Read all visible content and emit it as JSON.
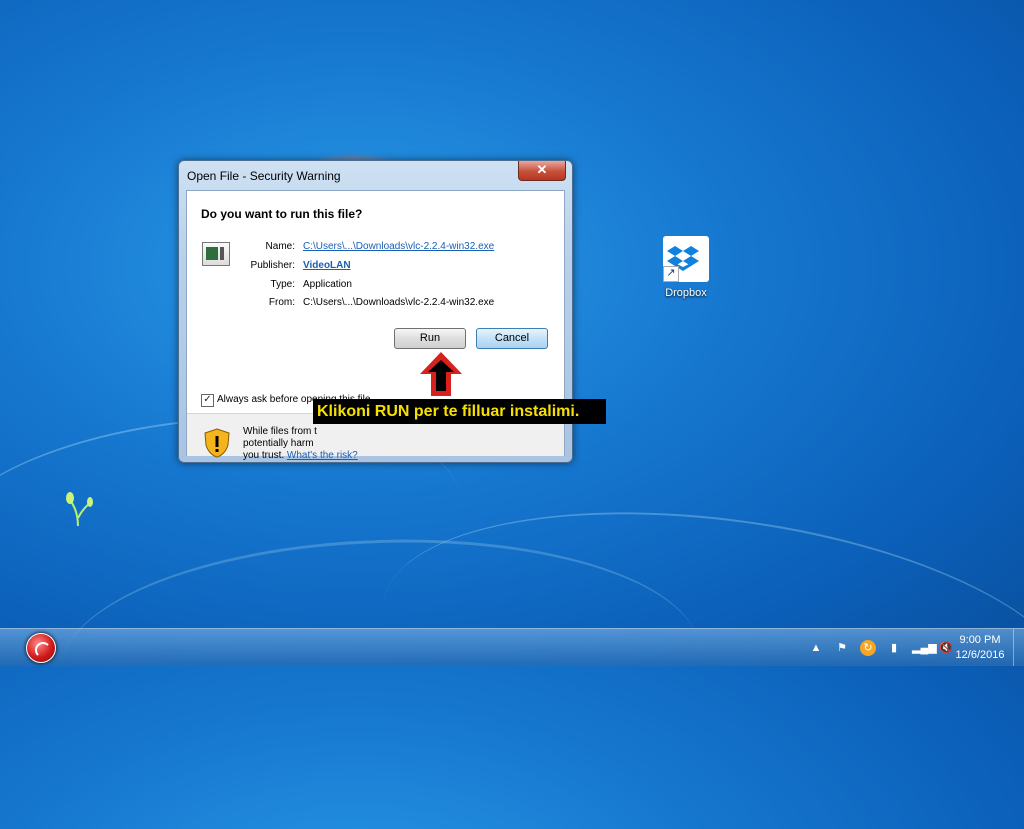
{
  "dialog": {
    "title": "Open File - Security Warning",
    "close_glyph": "✕",
    "question": "Do you want to run this file?",
    "name_label": "Name:",
    "name_value": "C:\\Users\\...\\Downloads\\vlc-2.2.4-win32.exe",
    "publisher_label": "Publisher:",
    "publisher_value": "VideoLAN",
    "type_label": "Type:",
    "type_value": "Application",
    "from_label": "From:",
    "from_value": "C:\\Users\\...\\Downloads\\vlc-2.2.4-win32.exe",
    "run_button": "Run",
    "cancel_button": "Cancel",
    "always_ask_label": "Always ask before opening this file",
    "always_ask_checked": true,
    "warning_line1": "While files from t",
    "warning_line2": "potentially harm",
    "warning_line3": "you trust.",
    "risk_link": "What's the risk?"
  },
  "annotation": {
    "text": "Klikoni RUN per te filluar instalimi."
  },
  "desktop": {
    "icons": [
      {
        "label": "Dropbox",
        "icon": "dropbox-icon"
      }
    ]
  },
  "taskbar": {
    "time": "9:00 PM",
    "date": "12/6/2016",
    "tray_icons": [
      "show-hidden-icon",
      "action-center-flag-icon",
      "update-icon",
      "battery-icon",
      "network-signal-icon",
      "volume-muted-icon"
    ]
  },
  "colors": {
    "annotation_bg": "#000000",
    "annotation_text": "#f6e000",
    "arrow": "#d8211c"
  }
}
